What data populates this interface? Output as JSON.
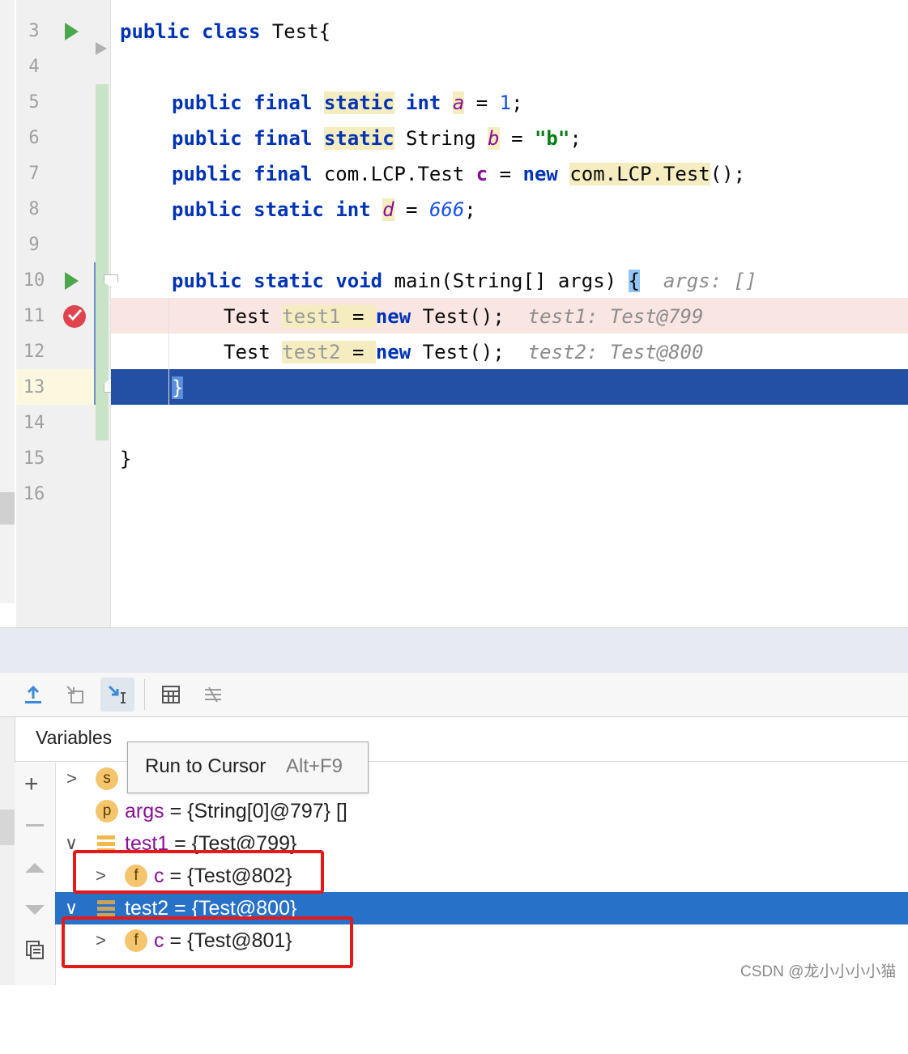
{
  "editor": {
    "line_numbers": [
      "3",
      "4",
      "5",
      "6",
      "7",
      "8",
      "9",
      "10",
      "11",
      "12",
      "13",
      "14",
      "15",
      "16"
    ],
    "l3": {
      "kw1": "public",
      "kw2": "class",
      "name": "Test{"
    },
    "l5": {
      "kw1": "public",
      "kw2": "final",
      "kw3": "static",
      "type": "int",
      "field": "a",
      "eq": " = ",
      "val": "1",
      ";": ";"
    },
    "l6": {
      "kw1": "public",
      "kw2": "final",
      "kw3": "static",
      "type": "String",
      "field": "b",
      "eq": " = ",
      "val": "\"b\"",
      ";": ";"
    },
    "l7": {
      "kw1": "public",
      "kw2": "final",
      "type": "com.LCP.Test",
      "field": "c",
      "eq": " = ",
      "kw4": "new",
      "ctor": "com.LCP.Test",
      "tail": "();"
    },
    "l8": {
      "kw1": "public",
      "kw2": "static",
      "type": "int",
      "field": "d",
      "eq": " = ",
      "val": "666",
      ";": ";"
    },
    "l10": {
      "kw1": "public",
      "kw2": "static",
      "kw3": "void",
      "sig": "main(String[] args) ",
      "brace": "{",
      "hint": "args: []"
    },
    "l11": {
      "type": "Test ",
      "var": "test1",
      "eq": " = ",
      "kw": "new",
      "rest": " Test();",
      "hint": "test1: Test@799"
    },
    "l12": {
      "type": "Test ",
      "var": "test2",
      "eq": " = ",
      "kw": "new",
      "rest": " Test();",
      "hint": "test2: Test@800"
    },
    "l13": {
      "brace": "}"
    },
    "l15": {
      "brace": "}"
    }
  },
  "debugger": {
    "tab_label": "Variables",
    "tooltip": {
      "label": "Run to Cursor",
      "shortcut": "Alt+F9"
    },
    "rows": [
      {
        "badge": "s",
        "name": "s",
        "value": ""
      },
      {
        "badge": "p",
        "name": "args",
        "value": " = {String[0]@797} []"
      },
      {
        "badge": "",
        "name": "test1",
        "value": " = {Test@799}"
      },
      {
        "badge": "f",
        "name": "c",
        "value": " = {Test@802}"
      },
      {
        "badge": "",
        "name": "test2",
        "value": " = {Test@800}"
      },
      {
        "badge": "f",
        "name": "c",
        "value": " = {Test@801}"
      }
    ]
  },
  "watermark": "CSDN @龙小小小小猫",
  "colors": {
    "selection": "#2871c8",
    "current_line": "#2350a5",
    "breakpoint": "#e0444f",
    "annotation_box": "#e4191a"
  }
}
